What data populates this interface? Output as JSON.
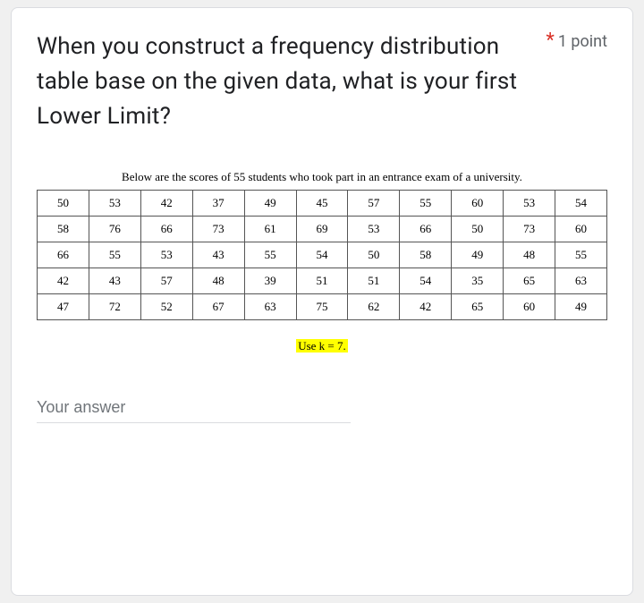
{
  "question": {
    "title": "When you construct a frequency distribution table base on the given data, what is your first Lower Limit?",
    "required_marker": "*",
    "points_label": "1 point"
  },
  "data_block": {
    "caption": "Below are the scores of 55 students who took part in an entrance exam of a university.",
    "rows": [
      [
        "50",
        "53",
        "42",
        "37",
        "49",
        "45",
        "57",
        "55",
        "60",
        "53",
        "54"
      ],
      [
        "58",
        "76",
        "66",
        "73",
        "61",
        "69",
        "53",
        "66",
        "50",
        "73",
        "60"
      ],
      [
        "66",
        "55",
        "53",
        "43",
        "55",
        "54",
        "50",
        "58",
        "49",
        "48",
        "55"
      ],
      [
        "42",
        "43",
        "57",
        "48",
        "39",
        "51",
        "51",
        "54",
        "35",
        "65",
        "63"
      ],
      [
        "47",
        "72",
        "52",
        "67",
        "63",
        "75",
        "62",
        "42",
        "65",
        "60",
        "49"
      ]
    ],
    "note": "Use k = 7."
  },
  "answer": {
    "placeholder": "Your answer"
  }
}
